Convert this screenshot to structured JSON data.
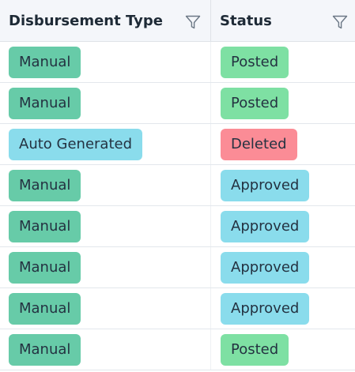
{
  "columns": {
    "type_header": "Disbursement Type",
    "status_header": "Status",
    "filter_icon": "funnel-filter-icon"
  },
  "colors": {
    "Manual": "#67cba8",
    "Auto Generated": "#8adcec",
    "Posted": "#7ee0a3",
    "Deleted": "#fb8c96",
    "Approved": "#8adcec"
  },
  "rows": [
    {
      "type": "Manual",
      "status": "Posted"
    },
    {
      "type": "Manual",
      "status": "Posted"
    },
    {
      "type": "Auto Generated",
      "status": "Deleted"
    },
    {
      "type": "Manual",
      "status": "Approved"
    },
    {
      "type": "Manual",
      "status": "Approved"
    },
    {
      "type": "Manual",
      "status": "Approved"
    },
    {
      "type": "Manual",
      "status": "Approved"
    },
    {
      "type": "Manual",
      "status": "Posted"
    }
  ]
}
